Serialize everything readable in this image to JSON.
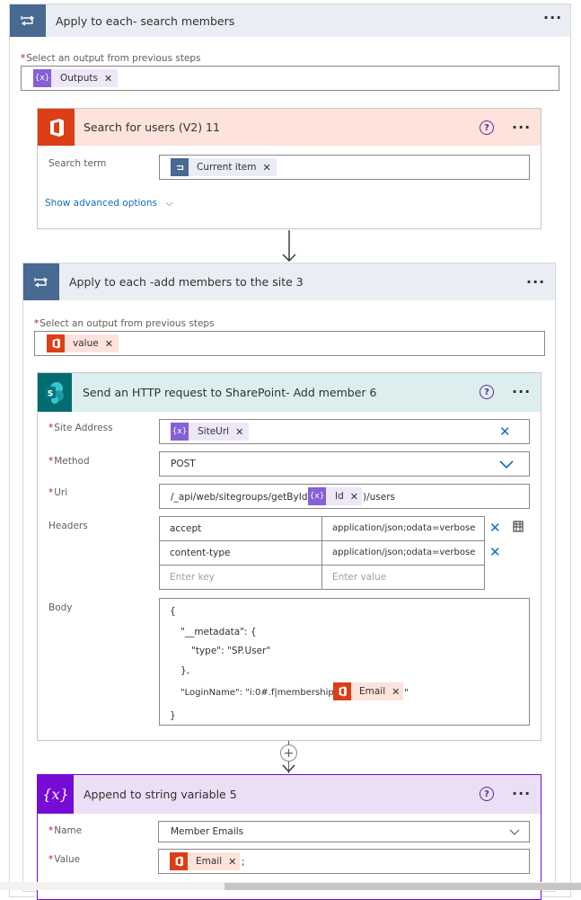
{
  "loop1": {
    "title": "Apply to each- search members",
    "select_label": "Select an output from previous steps",
    "token": "Outputs"
  },
  "search": {
    "title": "Search for users (V2) 11",
    "term_label": "Search term",
    "term_token": "Current item",
    "advanced": "Show advanced options"
  },
  "loop2": {
    "title": "Apply to each -add members to the site 3",
    "select_label": "Select an output from previous steps",
    "token": "value"
  },
  "http": {
    "title": "Send an HTTP request to SharePoint- Add member 6",
    "site_label": "Site Address",
    "site_token": "SiteUrl",
    "method_label": "Method",
    "method_value": "POST",
    "uri_label": "Uri",
    "uri_prefix": "/_api/web/sitegroups/getById(",
    "uri_token": "Id",
    "uri_suffix": ")/users",
    "headers_label": "Headers",
    "headers": [
      {
        "key": "accept",
        "value": "application/json;odata=verbose"
      },
      {
        "key": "content-type",
        "value": "application/json;odata=verbose"
      }
    ],
    "key_placeholder": "Enter key",
    "value_placeholder": "Enter value",
    "body_label": "Body",
    "body_lines": [
      "{",
      "\"__metadata\": {",
      "\"type\": \"SP.User\"",
      "},",
      "\"LoginName\": \"i:0#.f|membership|",
      "}"
    ],
    "body_token": "Email",
    "body_tail": "\""
  },
  "append": {
    "title": "Append to string variable 5",
    "name_label": "Name",
    "name_value": "Member Emails",
    "value_label": "Value",
    "value_token": "Email",
    "value_suffix": ";"
  },
  "colors": {
    "loop_header": "#eaedf3",
    "loop_icon": "#486991",
    "office_header": "#fde3db",
    "office_icon": "#dc3e15",
    "sharepoint_header": "#dcefee",
    "sharepoint_icon": "#036c70",
    "variable_header": "#eadff5",
    "variable_icon": "#770bd6",
    "expression_token": "#8660d6"
  }
}
